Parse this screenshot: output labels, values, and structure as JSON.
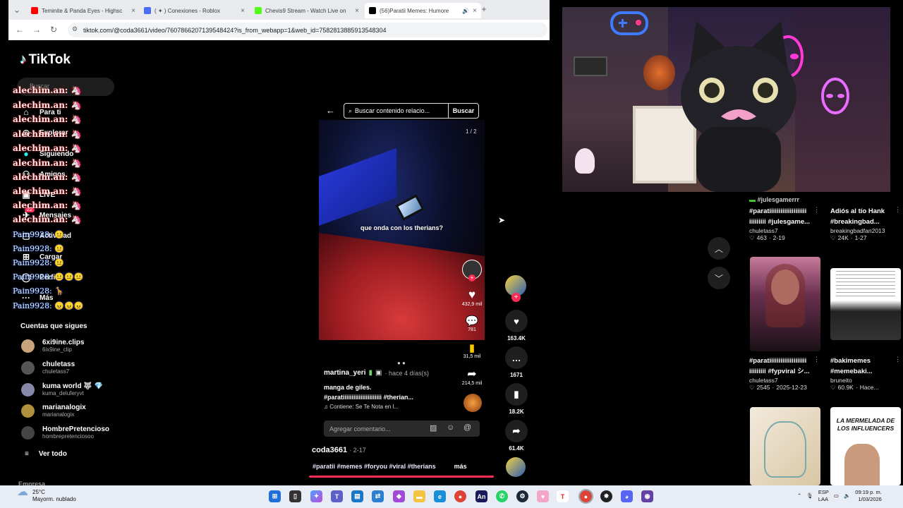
{
  "browser": {
    "tabs": [
      {
        "label": "Teminite & Panda Eyes - Highsc",
        "color": "#ff0000"
      },
      {
        "label": "( ✦ ) Conexiones - Roblox",
        "color": "#4b6cf7"
      },
      {
        "label": "Chevis9 Stream - Watch Live on",
        "color": "#53fc18"
      },
      {
        "label": "(56)Paratii Memes: Humore",
        "color": "#000000"
      }
    ],
    "new_tab": "+",
    "url": "tiktok.com/@coda3661/video/7607866207139548424?is_from_webapp=1&web_id=7582813885913548304"
  },
  "sidebar": {
    "logo": "TikTok",
    "search_placeholder": "Buscar",
    "nav": [
      {
        "label": "Para ti",
        "icon": "home-icon"
      },
      {
        "label": "Explorar",
        "icon": "compass-icon"
      },
      {
        "label": "Siguiendo",
        "icon": "following-icon"
      },
      {
        "label": "Amigos",
        "icon": "friends-icon"
      },
      {
        "label": "LIVE",
        "icon": "live-icon"
      },
      {
        "label": "Mensajes",
        "icon": "messages-icon",
        "badge": "22"
      },
      {
        "label": "Actividad",
        "icon": "activity-icon"
      },
      {
        "label": "Cargar",
        "icon": "upload-icon"
      },
      {
        "label": "Perfil",
        "icon": "profile-icon"
      },
      {
        "label": "Más",
        "icon": "more-icon"
      }
    ],
    "chat_overlay": {
      "user1": "alechim.an:",
      "user2": "Pain9928:"
    },
    "following_title": "Cuentas que sigues",
    "accounts": [
      {
        "name": "6xi9ine.clips",
        "handle": "6ix9ine_clip",
        "color": "#c9a37a"
      },
      {
        "name": "chuletass",
        "handle": "chuletass7",
        "color": "#555555"
      },
      {
        "name": "kuma world 🐺 💎",
        "handle": "kuma_deluferyvt",
        "color": "#8888aa"
      },
      {
        "name": "marianalogix",
        "handle": "marianalogix",
        "color": "#b0903c"
      },
      {
        "name": "HombrePretencioso",
        "handle": "hombrepretenciosoo",
        "color": "#444444"
      }
    ],
    "see_all": "Ver todo",
    "company": "Empresa"
  },
  "video": {
    "search_placeholder": "Buscar contenido relacio...",
    "search_button": "Buscar",
    "page_counter": "1 / 2",
    "caption": "que onda con los therians?",
    "inner_likes": "432,9 mil",
    "inner_comments": "781",
    "inner_saves": "31,5 mil",
    "inner_shares": "214,5 mil",
    "author": "martina_yeri",
    "time_ago": "· hace 4 días(s)",
    "desc_line1": "manga de giles.",
    "desc_line2": "#paratiiiiiiiiiiiiiiiiiiiiii #therian...",
    "music": "♫ Contiene: Se Te Nota en l...",
    "comment_placeholder": "Agregar comentario...",
    "creator": "coda3661",
    "creator_date": "· 2-17",
    "hashtags": "#paratii #memes #foryou #viral #therians",
    "more": "más"
  },
  "actions": {
    "likes": "163.4K",
    "comments": "1671",
    "saves": "18.2K",
    "shares": "61.4K"
  },
  "feed": [
    {
      "title1": "#paratiiiiiiiiiiiiiiiiiiii",
      "title2": "iiiiiiiii #julesgame...",
      "user": "chuletass7",
      "likes": "463",
      "date": "2-19"
    },
    {
      "title1": "Adiós al tío Hank",
      "title2": "#breakingbad...",
      "user": "breakingbadfan2013",
      "likes": "24K",
      "date": "1-27"
    },
    {
      "title1": "#paratiiiiiiiiiiiiiiiiiiii",
      "title2": "iiiiiiiii #fypviral シ...",
      "user": "chuletass7",
      "likes": "2545",
      "date": "2025-12-23"
    },
    {
      "title1": "#bakimemes",
      "title2": "#memebaki...",
      "user": "bruneito",
      "likes": "60.9K",
      "date": "Hace..."
    }
  ],
  "feed_top_partial": "#julesgamerrr",
  "thumb_text": {
    "memerelada": "LA MERMELADA DE LOS INFLUENCERS"
  },
  "taskbar": {
    "temp": "25°C",
    "weather": "Mayorm. nublado",
    "lang1": "ESP",
    "lang2": "LAA",
    "time": "09:19 p. m.",
    "date": "1/03/2026"
  }
}
